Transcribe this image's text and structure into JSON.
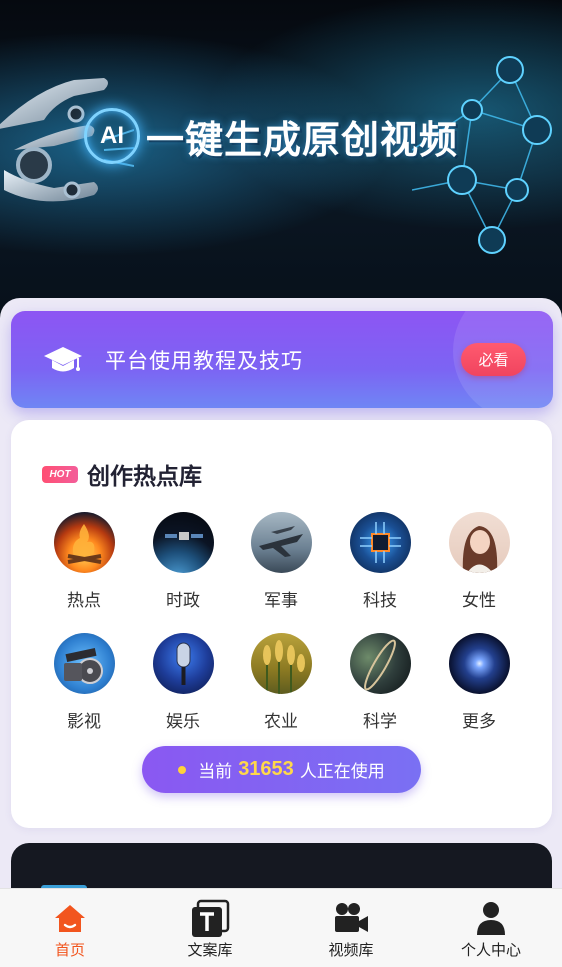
{
  "hero": {
    "badge": "AI",
    "title": "一键生成原创视频"
  },
  "tutorial": {
    "label": "平台使用教程及技巧",
    "badge": "必看",
    "icon": "graduation-cap-icon"
  },
  "hot_library": {
    "tag": "HOT",
    "title": "创作热点库",
    "categories": [
      {
        "label": "热点",
        "icon": "bonfire-image"
      },
      {
        "label": "时政",
        "icon": "earth-satellite-image"
      },
      {
        "label": "军事",
        "icon": "fighter-jet-image"
      },
      {
        "label": "科技",
        "icon": "chip-image"
      },
      {
        "label": "女性",
        "icon": "woman-portrait-image"
      },
      {
        "label": "影视",
        "icon": "film-reel-image"
      },
      {
        "label": "娱乐",
        "icon": "microphone-image"
      },
      {
        "label": "农业",
        "icon": "wheat-image"
      },
      {
        "label": "科学",
        "icon": "planet-image"
      },
      {
        "label": "更多",
        "icon": "galaxy-image"
      }
    ]
  },
  "usage": {
    "prefix": "当前",
    "count": "31653",
    "suffix": "人正在使用"
  },
  "tabbar": {
    "items": [
      {
        "label": "首页",
        "icon": "home-icon",
        "active": true
      },
      {
        "label": "文案库",
        "icon": "text-doc-icon",
        "active": false
      },
      {
        "label": "视频库",
        "icon": "video-camera-icon",
        "active": false
      },
      {
        "label": "个人中心",
        "icon": "user-icon",
        "active": false
      }
    ]
  },
  "colors": {
    "accent_purple": "#8a58f2",
    "badge_red": "#f0445f",
    "active_tab": "#f2551e",
    "count_yellow": "#ffd84a"
  }
}
